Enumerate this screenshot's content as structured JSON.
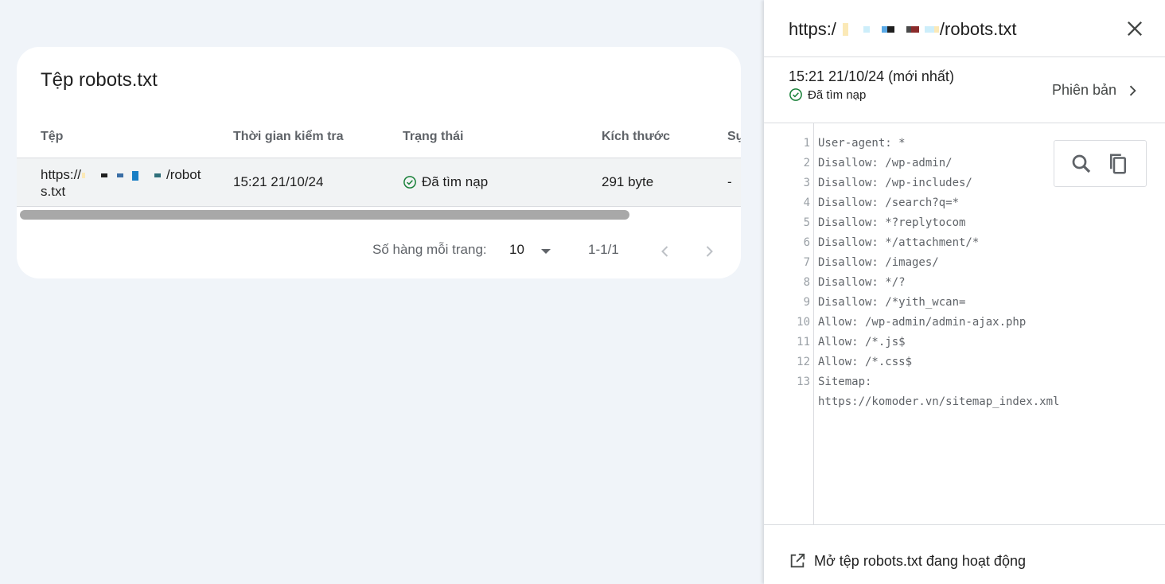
{
  "card": {
    "title": "Tệp robots.txt",
    "columns": [
      "Tệp",
      "Thời gian kiểm tra",
      "Trạng thái",
      "Kích thước",
      "Sự"
    ],
    "row": {
      "url_prefix": "https://",
      "url_suffix": "/robot",
      "url_line2": "s.txt",
      "checked_at": "15:21 21/10/24",
      "status": "Đã tìm nạp",
      "size": "291 byte",
      "extra": "-"
    },
    "pager": {
      "rows_per_page_label": "Số hàng mỗi trang:",
      "rows_per_page_value": "10",
      "range": "1-1/1"
    }
  },
  "panel": {
    "title_prefix": "https:/",
    "title_suffix": "/robots.txt",
    "timestamp": "15:21 21/10/24 (mới nhất)",
    "status": "Đã tìm nạp",
    "version_label": "Phiên bản",
    "footer_link": "Mở tệp robots.txt đang hoạt động",
    "code_lines": [
      {
        "n": "1",
        "text": "User-agent: *"
      },
      {
        "n": "2",
        "text": "Disallow: /wp-admin/"
      },
      {
        "n": "3",
        "text": "Disallow: /wp-includes/"
      },
      {
        "n": "4",
        "text": "Disallow: /search?q=*"
      },
      {
        "n": "5",
        "text": "Disallow: *?replytocom"
      },
      {
        "n": "6",
        "text": "Disallow: */attachment/*"
      },
      {
        "n": "7",
        "text": "Disallow: /images/"
      },
      {
        "n": "8",
        "text": "Disallow: */?"
      },
      {
        "n": "9",
        "text": "Disallow: /*yith_wcan="
      },
      {
        "n": "10",
        "text": "Allow: /wp-admin/admin-ajax.php"
      },
      {
        "n": "11",
        "text": "Allow: /*.js$"
      },
      {
        "n": "12",
        "text": "Allow: /*.css$"
      },
      {
        "n": "13",
        "text": "Sitemap:"
      },
      {
        "n": "",
        "text": "https://komoder.vn/sitemap_index.xml"
      }
    ]
  },
  "colors": {
    "success": "#188038",
    "background": "#f0f4f9",
    "border": "#dadce0",
    "muted": "#5f6368"
  },
  "icons": [
    "check-circle-icon",
    "dropdown-arrow-icon",
    "chevron-left-icon",
    "chevron-right-icon",
    "close-icon",
    "search-icon",
    "copy-icon",
    "open-in-new-icon"
  ]
}
